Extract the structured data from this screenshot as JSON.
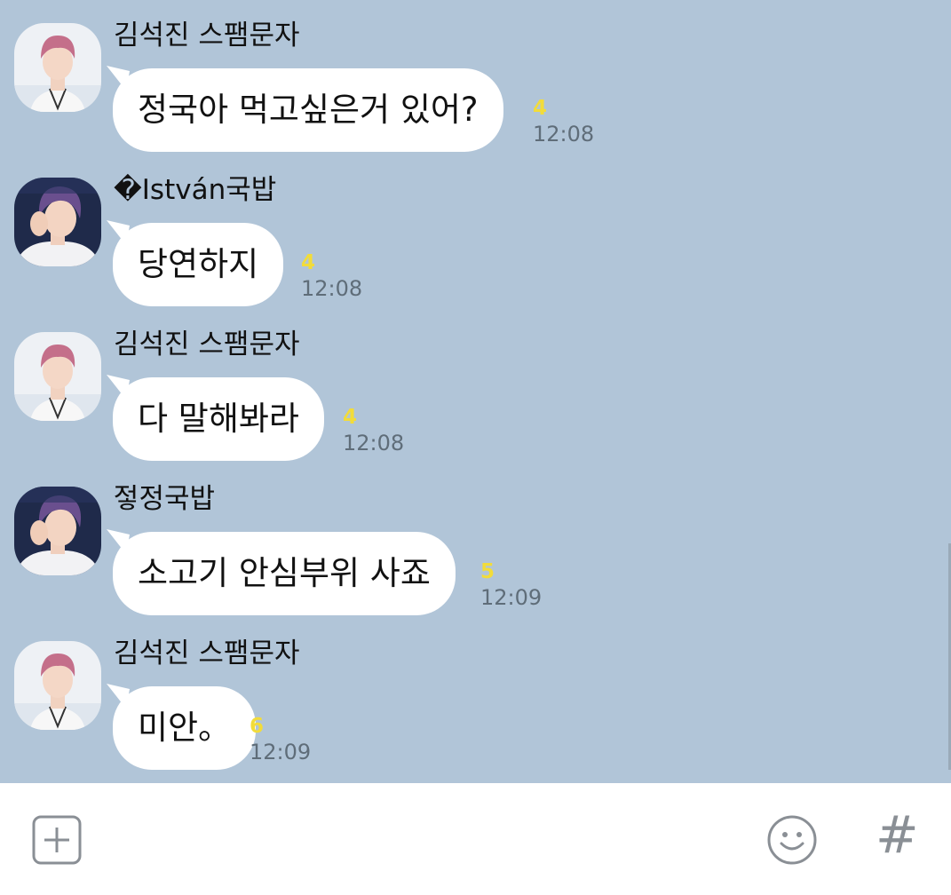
{
  "messages": [
    {
      "sender": "김석진 스팸문자",
      "text": "정국아 먹고싶은거 있어?",
      "unread": "4",
      "time": "12:08",
      "avatar": "jin"
    },
    {
      "sender": "�István국밥",
      "text": "당연하지",
      "unread": "4",
      "time": "12:08",
      "avatar": "jk"
    },
    {
      "sender": "김석진 스팸문자",
      "text": "다 말해봐라",
      "unread": "4",
      "time": "12:08",
      "avatar": "jin"
    },
    {
      "sender": "젛정국밥",
      "text": "소고기 안심부위 사죠",
      "unread": "5",
      "time": "12:09",
      "avatar": "jk"
    },
    {
      "sender": "김석진 스팸문자",
      "text": "미안。",
      "unread": "6",
      "time": "12:09",
      "avatar": "jin"
    }
  ],
  "input_bar": {
    "icons": [
      "plus-square-icon",
      "emoji-smile-icon",
      "hashtag-icon"
    ],
    "hash_label": "#"
  },
  "colors": {
    "chat_background": "#b1c5d8",
    "bubble": "#ffffff",
    "unread_count": "#f2dc3a",
    "time": "#5f6d79"
  }
}
